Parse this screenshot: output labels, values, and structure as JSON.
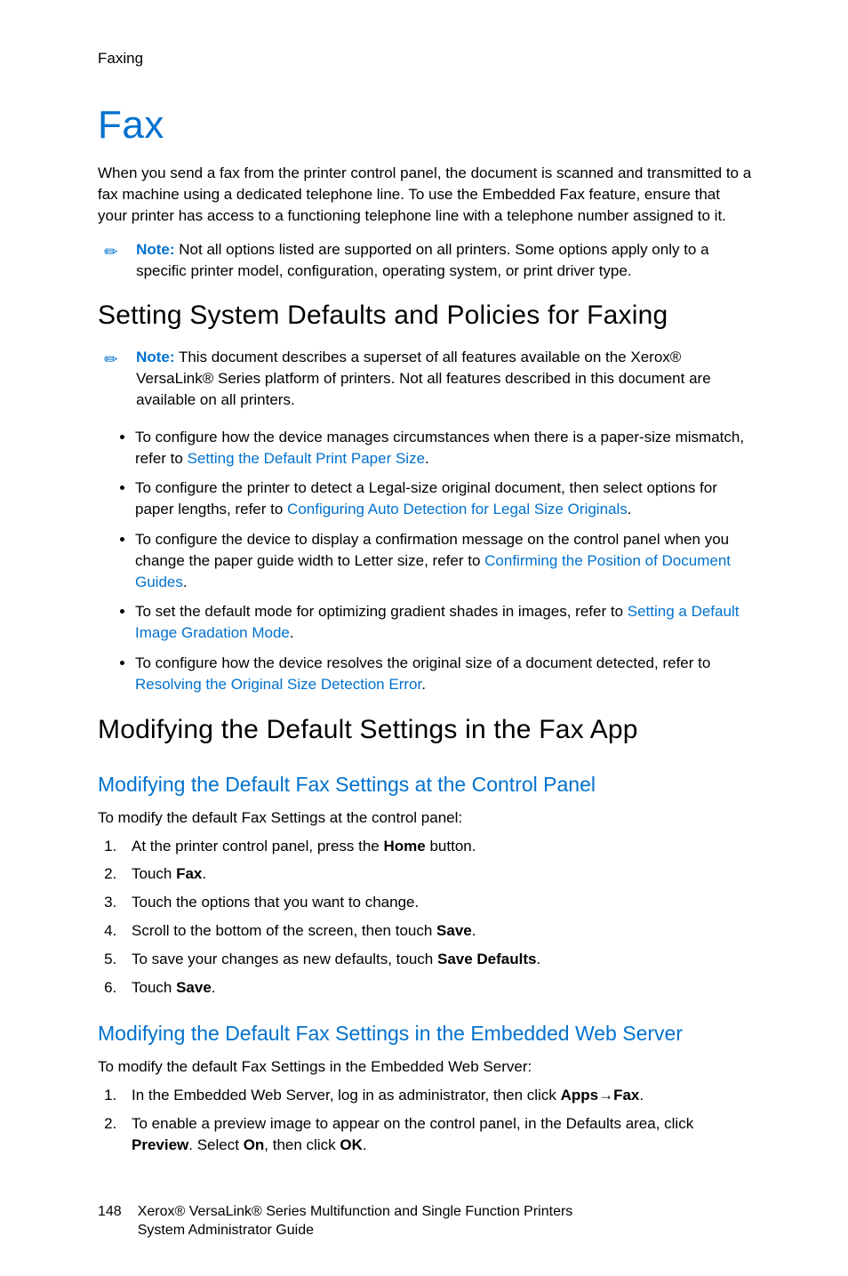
{
  "header": {
    "section_label": "Faxing"
  },
  "title": "Fax",
  "intro": "When you send a fax from the printer control panel, the document is scanned and transmitted to a fax machine using a dedicated telephone line. To use the Embedded Fax feature, ensure that your printer has access to a functioning telephone line with a telephone number assigned to it.",
  "note1": {
    "label": "Note:",
    "text": " Not all options listed are supported on all printers. Some options apply only to a specific printer model, configuration, operating system, or print driver type."
  },
  "h2a": "Setting System Defaults and Policies for Faxing",
  "note2": {
    "label": "Note:",
    "text": " This document describes a superset of all features available on the Xerox® VersaLink® Series platform of printers. Not all features described in this document are available on all printers."
  },
  "bullets": [
    {
      "pre": "To configure how the device manages circumstances when there is a paper-size mismatch, refer to ",
      "link": "Setting the Default Print Paper Size",
      "post": "."
    },
    {
      "pre": "To configure the printer to detect a Legal-size original document, then select options for paper lengths, refer to ",
      "link": "Configuring Auto Detection for Legal Size Originals",
      "post": "."
    },
    {
      "pre": "To configure the device to display a confirmation message on the control panel when you change the paper guide width to Letter size, refer to ",
      "link": "Confirming the Position of Document Guides",
      "post": "."
    },
    {
      "pre": "To set the default mode for optimizing gradient shades in images, refer to ",
      "link": "Setting a Default Image Gradation Mode",
      "post": "."
    },
    {
      "pre": "To configure how the device resolves the original size of a document detected, refer to ",
      "link": "Resolving the Original Size Detection Error",
      "post": "."
    }
  ],
  "h2b": "Modifying the Default Settings in the Fax App",
  "h3a": "Modifying the Default Fax Settings at the Control Panel",
  "lead_a": "To modify the default Fax Settings at the control panel:",
  "steps_a": [
    [
      {
        "t": "At the printer control panel, press the "
      },
      {
        "t": "Home",
        "b": true
      },
      {
        "t": " button."
      }
    ],
    [
      {
        "t": "Touch "
      },
      {
        "t": "Fax",
        "b": true
      },
      {
        "t": "."
      }
    ],
    [
      {
        "t": "Touch the options that you want to change."
      }
    ],
    [
      {
        "t": "Scroll to the bottom of the screen, then touch "
      },
      {
        "t": "Save",
        "b": true
      },
      {
        "t": "."
      }
    ],
    [
      {
        "t": "To save your changes as new defaults, touch "
      },
      {
        "t": "Save Defaults",
        "b": true
      },
      {
        "t": "."
      }
    ],
    [
      {
        "t": "Touch "
      },
      {
        "t": "Save",
        "b": true
      },
      {
        "t": "."
      }
    ]
  ],
  "h3b": "Modifying the Default Fax Settings in the Embedded Web Server",
  "lead_b": "To modify the default Fax Settings in the Embedded Web Server:",
  "steps_b": [
    [
      {
        "t": "In the Embedded Web Server, log in as administrator, then click "
      },
      {
        "t": "Apps",
        "b": true
      },
      {
        "t": "→"
      },
      {
        "t": "Fax",
        "b": true
      },
      {
        "t": "."
      }
    ],
    [
      {
        "t": "To enable a preview image to appear on the control panel, in the Defaults area, click "
      },
      {
        "t": "Preview",
        "b": true
      },
      {
        "t": ". Select "
      },
      {
        "t": "On",
        "b": true
      },
      {
        "t": ", then click "
      },
      {
        "t": "OK",
        "b": true
      },
      {
        "t": "."
      }
    ]
  ],
  "footer": {
    "page": "148",
    "line1": "Xerox® VersaLink® Series Multifunction and Single Function Printers",
    "line2": "System Administrator Guide"
  }
}
